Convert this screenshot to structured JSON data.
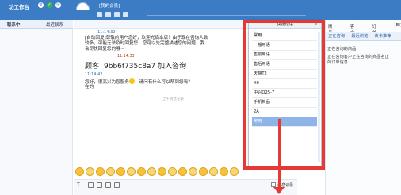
{
  "app": {
    "title": "功工作台",
    "user": "[我的会员]"
  },
  "tabs": {
    "contacts": "联系中",
    "recent": "最近联系"
  },
  "chat": {
    "ts1": "11:14:32",
    "line1": "[自动回复]尊敬的用户您好，欢迎光临本店！由于现在咨询人数",
    "line2": "较多，可能无法及时回复您，您可以先完整描述您的问题，我",
    "line3": "会尽快回复您的哦~",
    "big_label": "顾客",
    "big_id": "9bb6f735c8a7",
    "big_suffix": "加入咨询",
    "red_ts": "11:14:33",
    "ts2": "11:14:42",
    "line4": "您好，很高兴为您服务",
    "line4b": "，请问有什么可以帮到您吗？",
    "line5": "在的",
    "faint": "上午消息记录"
  },
  "input": {
    "label": "T",
    "record": "消息记录"
  },
  "quick": {
    "title": "快捷短语",
    "close": "×",
    "items": [
      "常用",
      "一般用语",
      "售前用语",
      "售后用语",
      "天猫T2",
      "X6",
      "中兴Q25-7",
      "手机新品",
      "2A",
      "常用"
    ],
    "selected_index": 9
  },
  "right": {
    "tabs1": [
      "商品",
      "客户",
      "订单",
      "[BI]"
    ],
    "tabs2": [
      "正在咨询",
      "最近浏览",
      "该卡推荐"
    ],
    "lines": [
      "正在咨询的商品：",
      "正在咨询客户正在咨询的商品名正",
      "的订单信息"
    ]
  }
}
